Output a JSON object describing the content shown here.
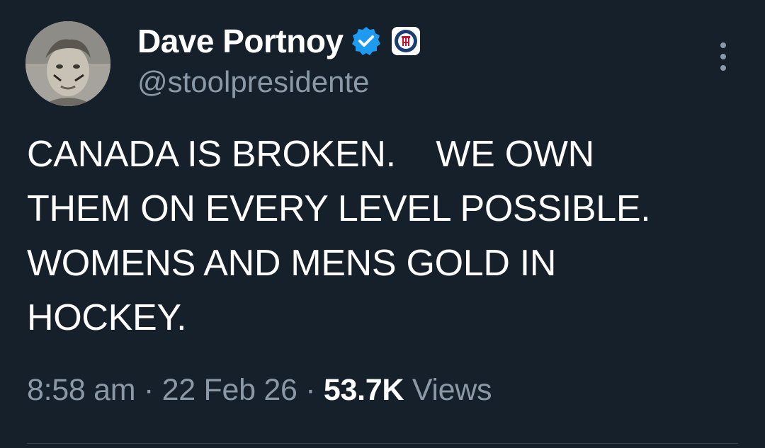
{
  "author": {
    "display_name": "Dave Portnoy",
    "handle": "@stoolpresidente",
    "verified_icon": "verified-badge-icon",
    "affiliate_icon": "barstool-sports-logo-icon"
  },
  "tweet": {
    "text": "CANADA IS BROKEN.    WE OWN\nTHEM ON EVERY LEVEL POSSIBLE.\nWOMENS AND MENS GOLD IN\nHOCKEY."
  },
  "meta": {
    "time": "8:58 am",
    "separator": "·",
    "date": "22 Feb 26",
    "views_count": "53.7K",
    "views_label": "Views"
  },
  "colors": {
    "background": "#15202b",
    "text_primary": "#ffffff",
    "text_secondary": "#8b98a5",
    "verified_blue": "#1d9bf0"
  }
}
